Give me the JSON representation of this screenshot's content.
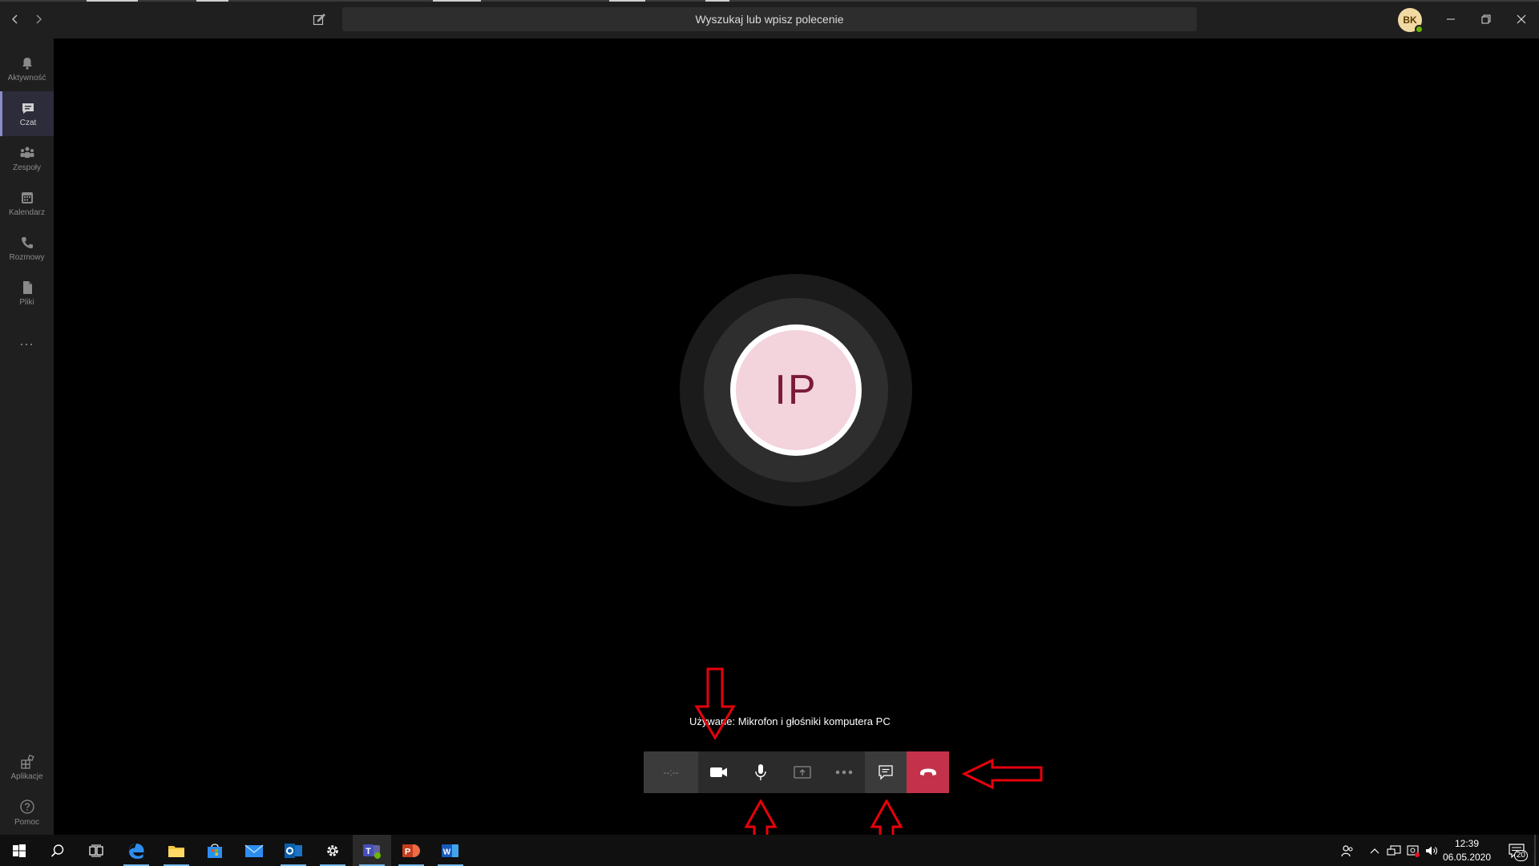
{
  "app": {
    "search_placeholder": "Wyszukaj lub wpisz polecenie",
    "user_initials": "BK"
  },
  "sidebar": {
    "items": [
      {
        "label": "Aktywność",
        "icon": "bell-icon"
      },
      {
        "label": "Czat",
        "icon": "chat-icon"
      },
      {
        "label": "Zespoły",
        "icon": "teams-icon"
      },
      {
        "label": "Kalendarz",
        "icon": "calendar-icon"
      },
      {
        "label": "Rozmowy",
        "icon": "phone-icon"
      },
      {
        "label": "Pliki",
        "icon": "files-icon"
      }
    ],
    "more": "...",
    "apps_label": "Aplikacje",
    "help_label": "Pomoc"
  },
  "call": {
    "participant_initials": "IP",
    "using_text": "Używane: Mikrofon i głośniki komputera PC",
    "timer": "--:--",
    "controls": [
      "camera-icon",
      "microphone-icon",
      "share-screen-icon",
      "more-icon",
      "chat-icon",
      "hang-up-icon"
    ]
  },
  "taskbar": {
    "time": "12:39",
    "date": "06.05.2020",
    "notifications": "20"
  },
  "colors": {
    "hangup": "#c4314b",
    "accent": "#8b8cc7",
    "annotation_arrow": "#e8000b"
  }
}
